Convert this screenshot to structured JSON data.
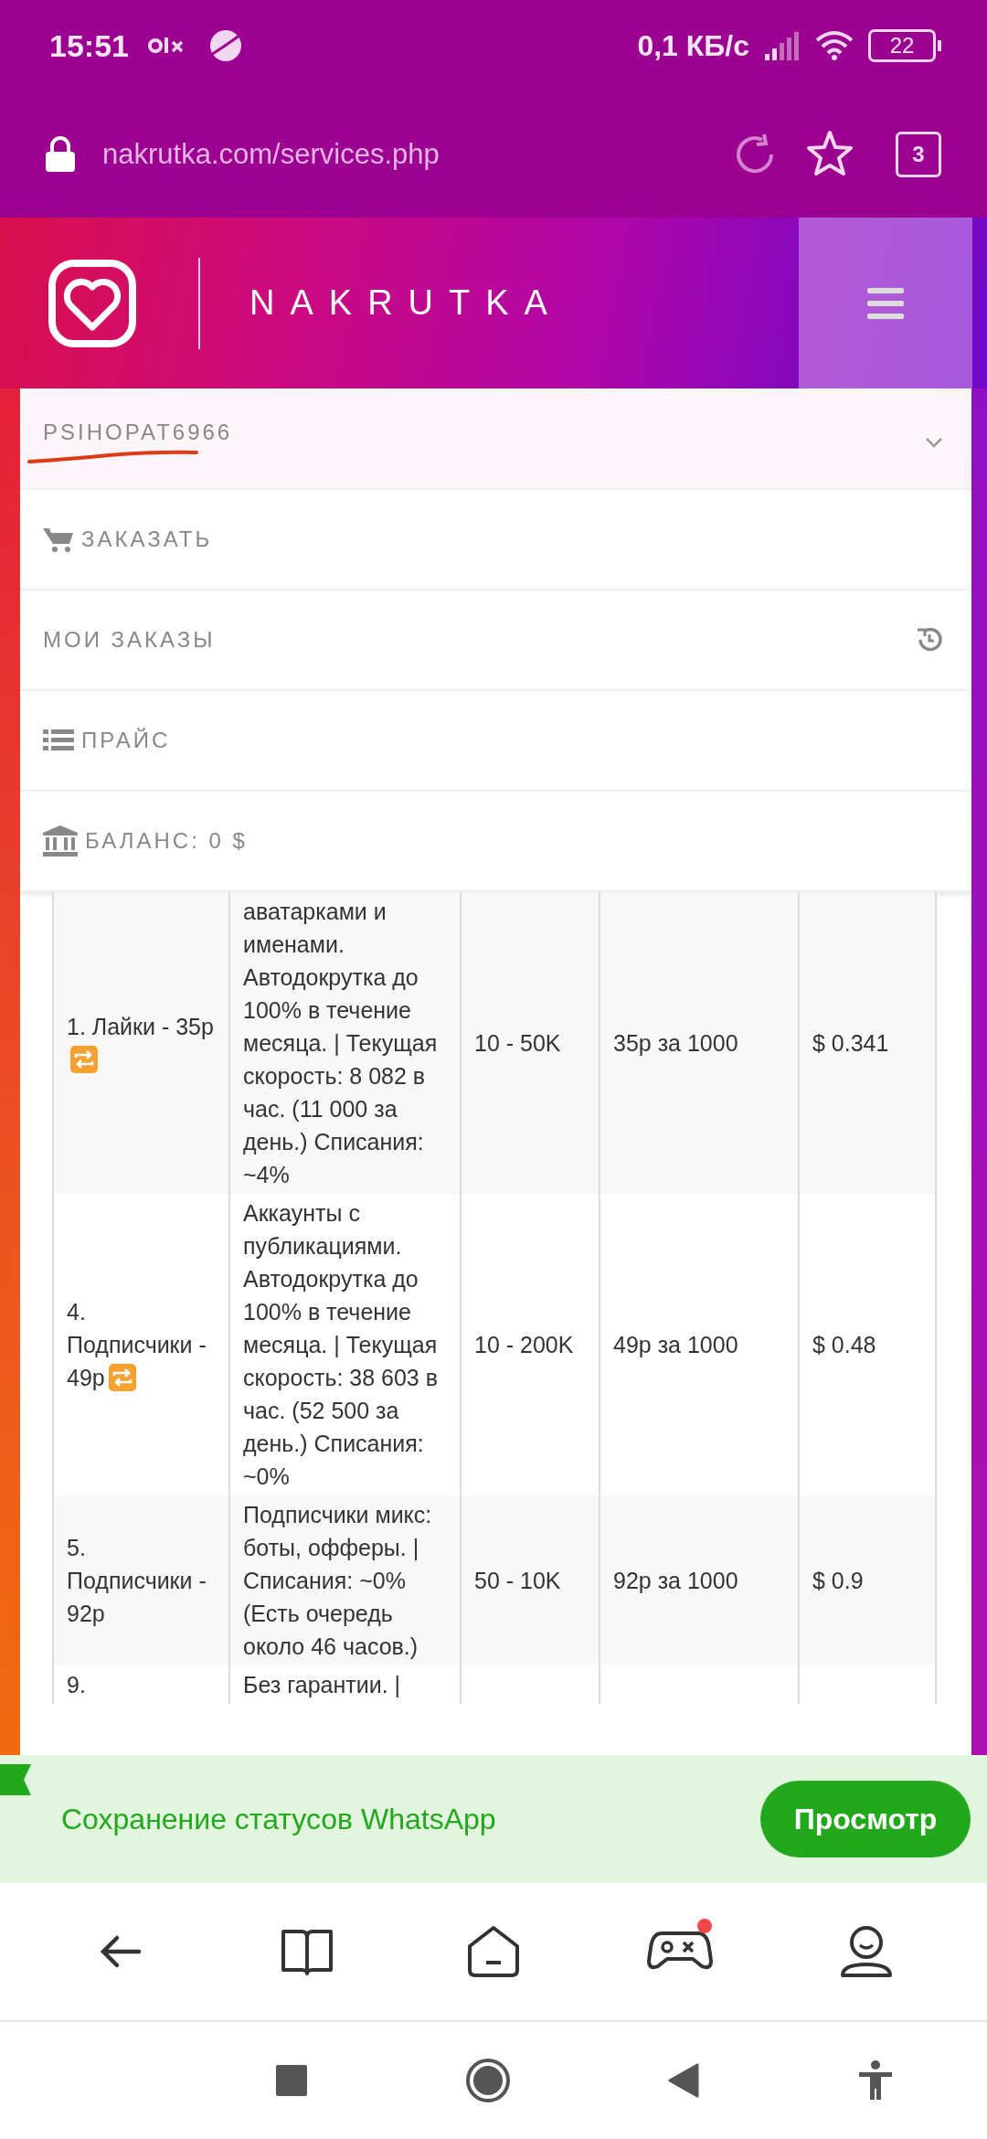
{
  "status_bar": {
    "time": "15:51",
    "network_speed": "0,1 КБ/с",
    "battery": "22"
  },
  "browser": {
    "url": "nakrutka.com/services.php",
    "tab_count": "3"
  },
  "header": {
    "logo_text": "NAKRUTKA"
  },
  "user_menu": {
    "username": "PSIHOPAT6966",
    "expanded": true,
    "items": [
      {
        "kind": "cart",
        "label": "ЗАКАЗАТЬ"
      },
      {
        "kind": "history",
        "label": "МОИ ЗАКАЗЫ"
      },
      {
        "kind": "list",
        "label": "ПРАЙС"
      },
      {
        "kind": "bank",
        "label": "БАЛАНС: 0 $"
      }
    ]
  },
  "table": {
    "rows": [
      {
        "service": "1. Лайки - 35р",
        "auto_refill": true,
        "description": "аватарками и именами. Автодокрутка до 100% в течение месяца. | Текущая скорость: 8 082 в час. (11 000 за день.) Списания: ~4%",
        "min_max": "10 - 50K",
        "cost_rub": "35р за 1000",
        "price_usd": "$ 0.341"
      },
      {
        "service": "4. Подписчики - 49р",
        "auto_refill": true,
        "description": "Аккаунты с публикациями. Автодокрутка до 100% в течение месяца. | Текущая скорость: 38 603 в час. (52 500 за день.) Списания: ~0%",
        "min_max": "10 - 200K",
        "cost_rub": "49р за 1000",
        "price_usd": "$ 0.48"
      },
      {
        "service": "5. Подписчики - 92р",
        "auto_refill": false,
        "description": "Подписчики микс: боты, офферы. | Списания: ~0% (Есть очередь около 46 часов.)",
        "min_max": "50 - 10K",
        "cost_rub": "92р за 1000",
        "price_usd": "$ 0.9"
      },
      {
        "service": "9.",
        "auto_refill": false,
        "description": "Без гарантии. |"
      }
    ]
  },
  "ad_banner": {
    "text": "Сохранение статусов WhatsApp",
    "button": "Просмотр"
  },
  "bottom_nav": {
    "items": [
      {
        "kind": "back",
        "badge": false
      },
      {
        "kind": "book",
        "badge": false
      },
      {
        "kind": "home",
        "badge": false
      },
      {
        "kind": "games",
        "badge": true
      },
      {
        "kind": "profile",
        "badge": false
      }
    ]
  }
}
